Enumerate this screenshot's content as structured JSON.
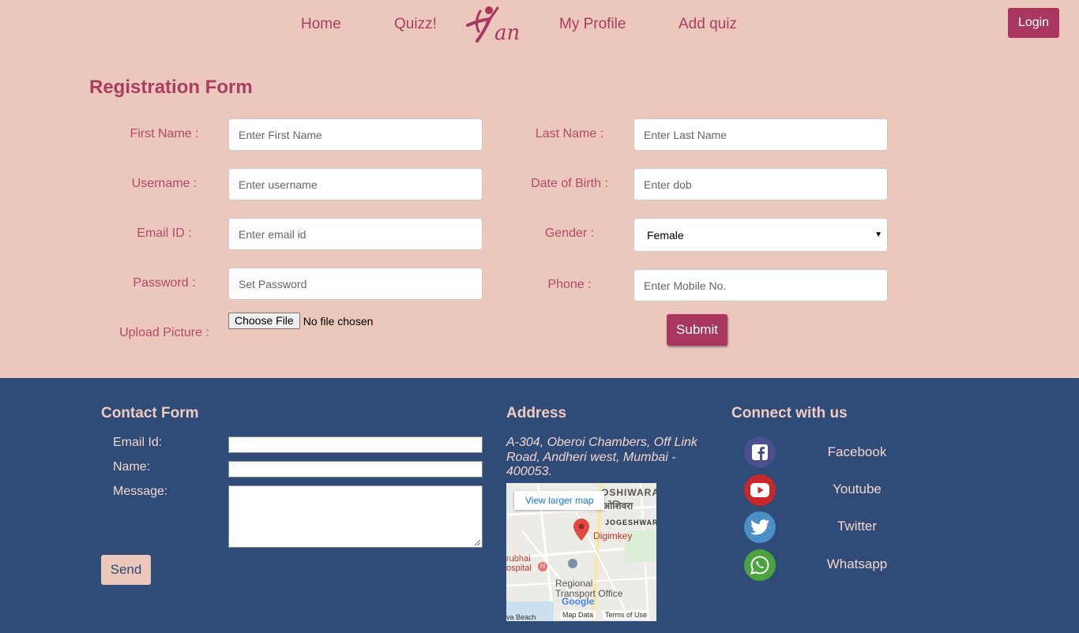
{
  "nav": {
    "items": [
      "Home",
      "Quizz!",
      "My Profile",
      "Add quiz"
    ],
    "logo_text": "Kan",
    "login": "Login"
  },
  "registration": {
    "title": "Registration Form",
    "first_name": {
      "label": "First Name :",
      "placeholder": "Enter First Name"
    },
    "last_name": {
      "label": "Last Name :",
      "placeholder": "Enter Last Name"
    },
    "username": {
      "label": "Username :",
      "placeholder": "Enter username"
    },
    "dob": {
      "label": "Date of Birth :",
      "placeholder": "Enter dob"
    },
    "email": {
      "label": "Email ID :",
      "placeholder": "Enter email id"
    },
    "gender": {
      "label": "Gender :",
      "selected": "Female"
    },
    "password": {
      "label": "Password :",
      "placeholder": "Set Password"
    },
    "phone": {
      "label": "Phone :",
      "placeholder": "Enter Mobile No."
    },
    "picture": {
      "label": "Upload Picture :",
      "button": "Choose File",
      "status": "No file chosen"
    },
    "submit": "Submit"
  },
  "footer": {
    "contact": {
      "title": "Contact Form",
      "email_label": "Email Id:",
      "name_label": "Name:",
      "message_label": "Message:",
      "send": "Send"
    },
    "address": {
      "title": "Address",
      "text": "A-304, Oberoi Chambers, Off Link Road, Andheri west, Mumbai - 400053."
    },
    "map": {
      "larger": "View larger map",
      "area1": "OSHIWARA",
      "area1_local": "ओशिवरा",
      "area2": "JOGESHWARI",
      "marker": "Digimkey",
      "hospital": "rubhai\nospital",
      "rto1": "Regional",
      "rto2": "Transport Office",
      "beach": "va Beach",
      "map_data": "Map Data",
      "terms": "Terms of Use",
      "google": "Google"
    },
    "connect": {
      "title": "Connect with us",
      "items": [
        {
          "name": "Facebook",
          "icon": "facebook-icon",
          "color": "#3b5998"
        },
        {
          "name": "Youtube",
          "icon": "youtube-icon",
          "color": "#cd201f"
        },
        {
          "name": "Twitter",
          "icon": "twitter-icon",
          "color": "#55acee"
        },
        {
          "name": "Whatsapp",
          "icon": "whatsapp-icon",
          "color": "#43a047"
        }
      ]
    }
  }
}
